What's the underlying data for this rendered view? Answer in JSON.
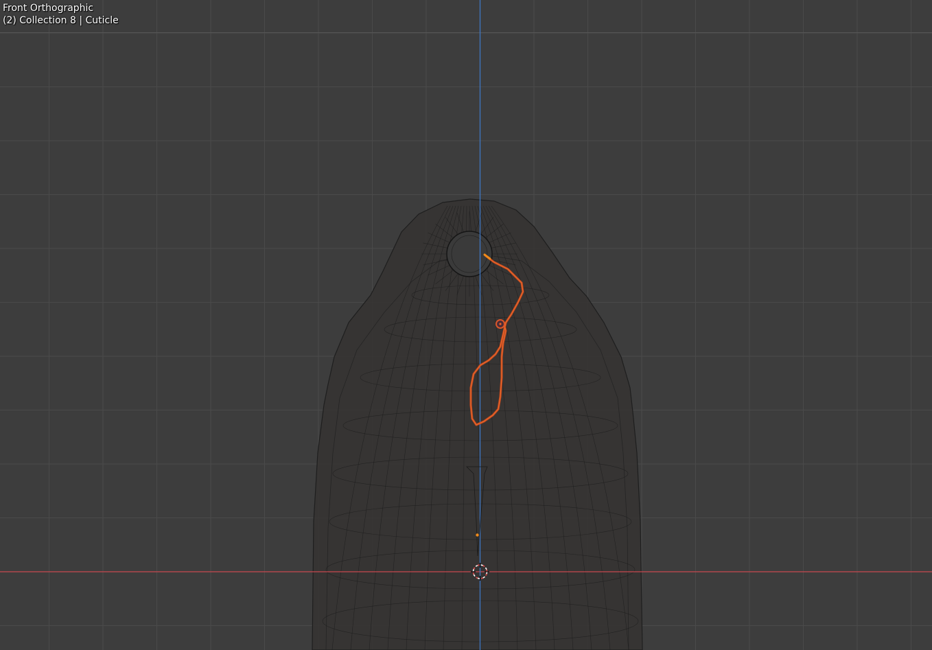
{
  "viewport": {
    "view_name": "Front Orthographic",
    "collection_info": "(2) Collection 8 | Cuticle",
    "colors": {
      "background": "#3d3d3d",
      "grid_minor": "#474747",
      "grid_major": "#525252",
      "x_axis": "#c8484f",
      "z_axis": "#3f77c4",
      "wireframe": "#1a1a1a",
      "selected": "#e8652a",
      "active_outline": "#d9562a",
      "origin_point": "#f08a1a",
      "cursor": "#ffffff"
    },
    "icons": [
      "3d-cursor-icon",
      "object-origin-icon"
    ]
  }
}
